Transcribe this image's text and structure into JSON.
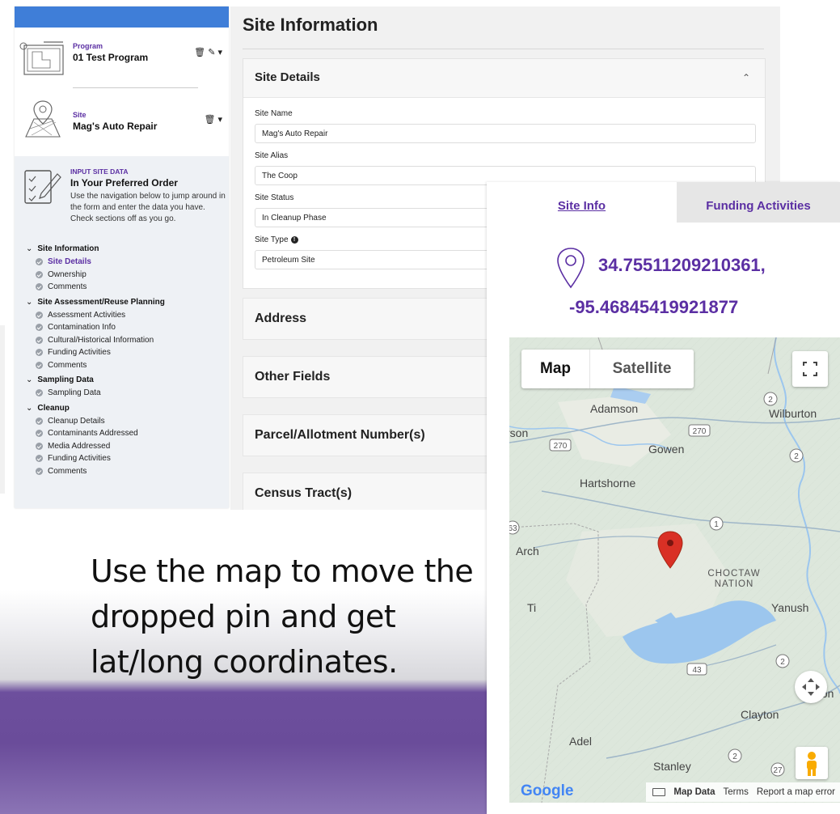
{
  "caption": "Use the map to move the dropped pin and get lat/long coordinates.",
  "left_panel": {
    "program": {
      "kicker": "Program",
      "value": "01 Test Program"
    },
    "site": {
      "kicker": "Site",
      "value": "Mag's Auto Repair"
    },
    "action_icons": {
      "program": "🗑 ✎ ▾",
      "site": "🗑 ▾"
    },
    "nav_intro": {
      "kicker": "INPUT SITE DATA",
      "heading": "In Your Preferred Order",
      "help": "Use the navigation below to jump around in the form and enter the data you have. Check sections off as you go."
    },
    "nav_sections": [
      {
        "label": "Site Information",
        "items": [
          "Site Details",
          "Ownership",
          "Comments"
        ]
      },
      {
        "label": "Site Assessment/Reuse Planning",
        "items": [
          "Assessment Activities",
          "Contamination Info",
          "Cultural/Historical Information",
          "Funding Activities",
          "Comments"
        ]
      },
      {
        "label": "Sampling Data",
        "items": [
          "Sampling Data"
        ]
      },
      {
        "label": "Cleanup",
        "items": [
          "Cleanup Details",
          "Contaminants Addressed",
          "Media Addressed",
          "Funding Activities",
          "Comments"
        ]
      }
    ]
  },
  "mid_panel": {
    "title": "Site Information",
    "details": {
      "title": "Site Details",
      "fields": [
        {
          "label": "Site Name",
          "value": "Mag's Auto Repair"
        },
        {
          "label": "Site Alias",
          "value": "The Coop"
        },
        {
          "label": "Site Status",
          "value": "In Cleanup Phase"
        },
        {
          "label": "Site Type",
          "value": "Petroleum Site"
        }
      ]
    },
    "sections": [
      "Address",
      "Other Fields",
      "Parcel/Allotment Number(s)",
      "Census Tract(s)"
    ]
  },
  "right_panel": {
    "tabs": {
      "site_info": "Site Info",
      "funding": "Funding Activities"
    },
    "coords": {
      "lat": "34.75511209210361,",
      "lng": "-95.46845419921877"
    },
    "map": {
      "type_map": "Map",
      "type_satellite": "Satellite",
      "places": [
        "Adamson",
        "Wilburton",
        "rson",
        "Gowen",
        "Hartshorne",
        "Arch",
        "Ti",
        "Yanush",
        "Clayton",
        "Adel",
        "Stanley",
        "ton"
      ],
      "region": "CHOCTAW NATION",
      "route_shields": [
        "270",
        "270",
        "2",
        "2",
        "1",
        "63",
        "43",
        "2",
        "2",
        "27"
      ],
      "google": "Google",
      "footer": {
        "map_data": "Map Data",
        "terms": "Terms",
        "report": "Report a map error"
      }
    }
  },
  "colors": {
    "accent": "#5b2fa3",
    "topbar": "#3f7ed8",
    "pin": "#d93025",
    "water": "#9cc6ee"
  }
}
